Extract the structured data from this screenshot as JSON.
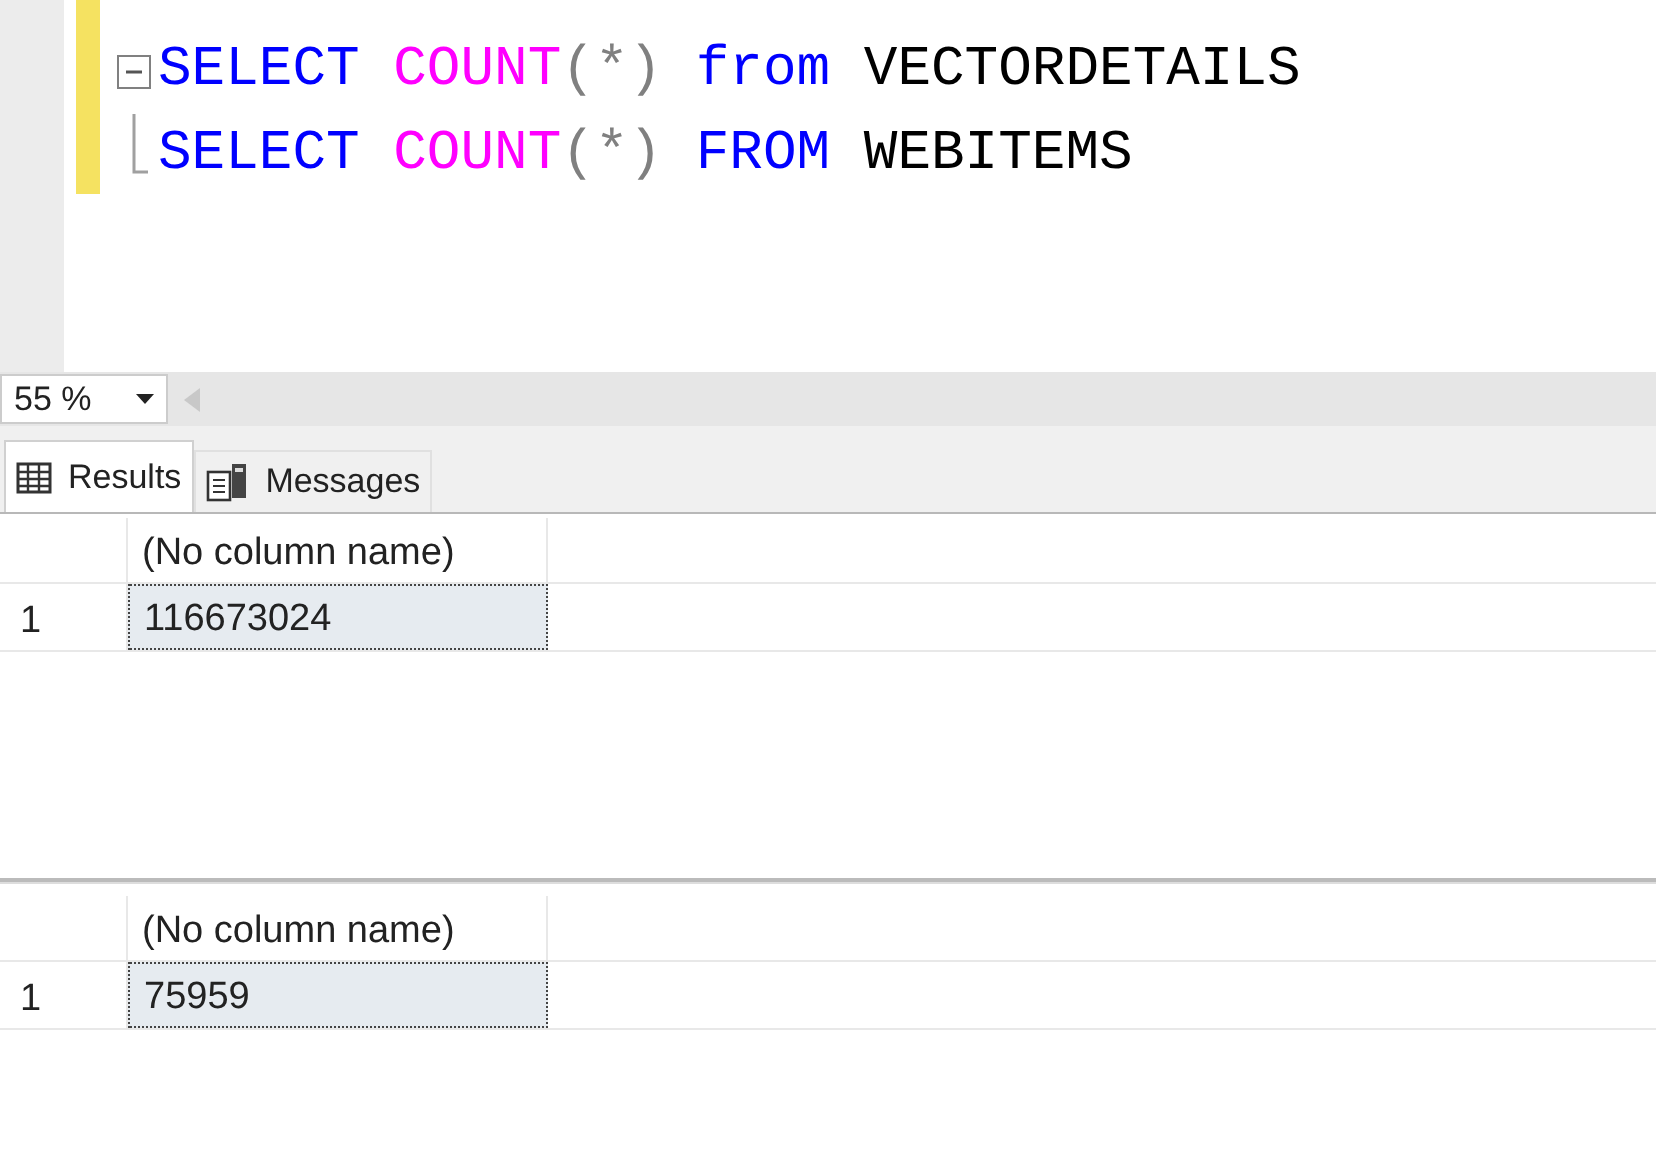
{
  "editor": {
    "lines": [
      {
        "kind": "collapsible",
        "tokens": [
          {
            "kind": "keyword",
            "text": "SELECT"
          },
          {
            "kind": "function",
            "text": "COUNT"
          },
          {
            "kind": "punct",
            "text": "(*)"
          },
          {
            "kind": "keyword",
            "text": "from"
          },
          {
            "kind": "ident",
            "text": "VECTORDETAILS"
          }
        ]
      },
      {
        "kind": "continuation",
        "tokens": [
          {
            "kind": "keyword",
            "text": "SELECT"
          },
          {
            "kind": "function",
            "text": "COUNT"
          },
          {
            "kind": "punct",
            "text": "(*)"
          },
          {
            "kind": "keyword",
            "text": "FROM"
          },
          {
            "kind": "ident",
            "text": "WEBITEMS"
          }
        ]
      }
    ]
  },
  "zoom": {
    "value": "55 %"
  },
  "tabs": [
    {
      "label": "Results",
      "selected": true
    },
    {
      "label": "Messages",
      "selected": false
    }
  ],
  "results": [
    {
      "column": "(No column name)",
      "rows": [
        {
          "number": "1",
          "value": "116673024",
          "selected": true
        }
      ]
    },
    {
      "column": "(No column name)",
      "rows": [
        {
          "number": "1",
          "value": "75959",
          "selected": true
        }
      ]
    }
  ]
}
